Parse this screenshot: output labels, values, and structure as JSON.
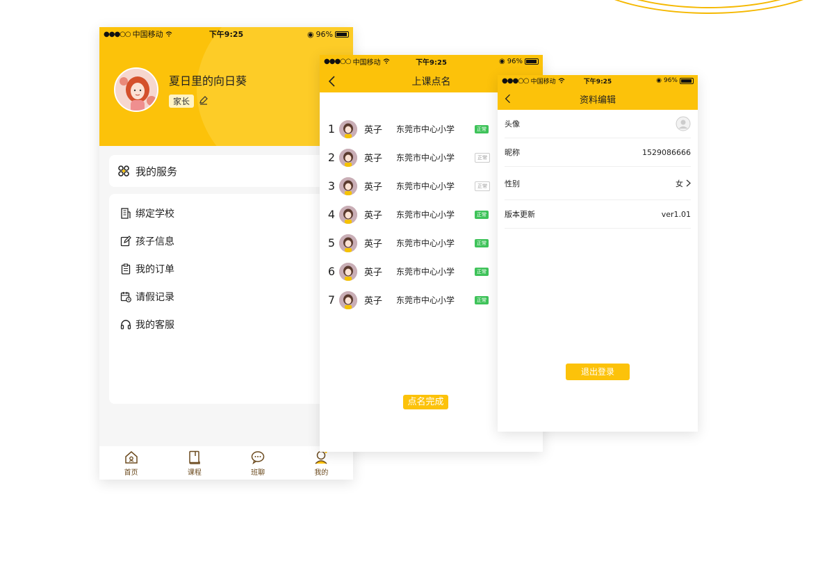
{
  "status_bar": {
    "carrier": "中国移动",
    "time": "下午9:25",
    "battery": "96%"
  },
  "profile": {
    "name": "夏日里的向日葵",
    "role": "家长"
  },
  "services": {
    "title": "我的服务"
  },
  "menu": {
    "items": [
      {
        "label": "绑定学校",
        "icon": "building-icon"
      },
      {
        "label": "孩子信息",
        "icon": "edit-icon"
      },
      {
        "label": "我的订单",
        "icon": "clipboard-icon"
      },
      {
        "label": "请假记录",
        "icon": "calendar-clock-icon"
      },
      {
        "label": "我的客服",
        "icon": "headset-icon"
      }
    ]
  },
  "tabs": [
    {
      "label": "首页",
      "icon": "home-icon"
    },
    {
      "label": "课程",
      "icon": "book-icon"
    },
    {
      "label": "班聊",
      "icon": "chat-icon"
    },
    {
      "label": "我的",
      "icon": "user-icon"
    }
  ],
  "attendance": {
    "title": "上课点名",
    "rows": [
      {
        "num": "1",
        "name": "英子",
        "school": "东莞市中心小学",
        "status": "正常",
        "normal": true
      },
      {
        "num": "2",
        "name": "英子",
        "school": "东莞市中心小学",
        "status": "正常",
        "normal": false
      },
      {
        "num": "3",
        "name": "英子",
        "school": "东莞市中心小学",
        "status": "正常",
        "normal": false
      },
      {
        "num": "4",
        "name": "英子",
        "school": "东莞市中心小学",
        "status": "正常",
        "normal": true
      },
      {
        "num": "5",
        "name": "英子",
        "school": "东莞市中心小学",
        "status": "正常",
        "normal": true
      },
      {
        "num": "6",
        "name": "英子",
        "school": "东莞市中心小学",
        "status": "正常",
        "normal": true
      },
      {
        "num": "7",
        "name": "英子",
        "school": "东莞市中心小学",
        "status": "正常",
        "normal": true
      }
    ],
    "finish_label": "点名完成"
  },
  "edit_profile": {
    "title": "资料编辑",
    "avatar_label": "头像",
    "nickname_label": "昵称",
    "nickname_value": "1529086666",
    "gender_label": "性别",
    "gender_value": "女",
    "version_label": "版本更新",
    "version_value": "ver1.01",
    "logout_label": "退出登录"
  },
  "colors": {
    "brand_yellow": "#fcc20a",
    "status_green": "#3fc35a",
    "tab_brown": "#6b4a1e"
  }
}
